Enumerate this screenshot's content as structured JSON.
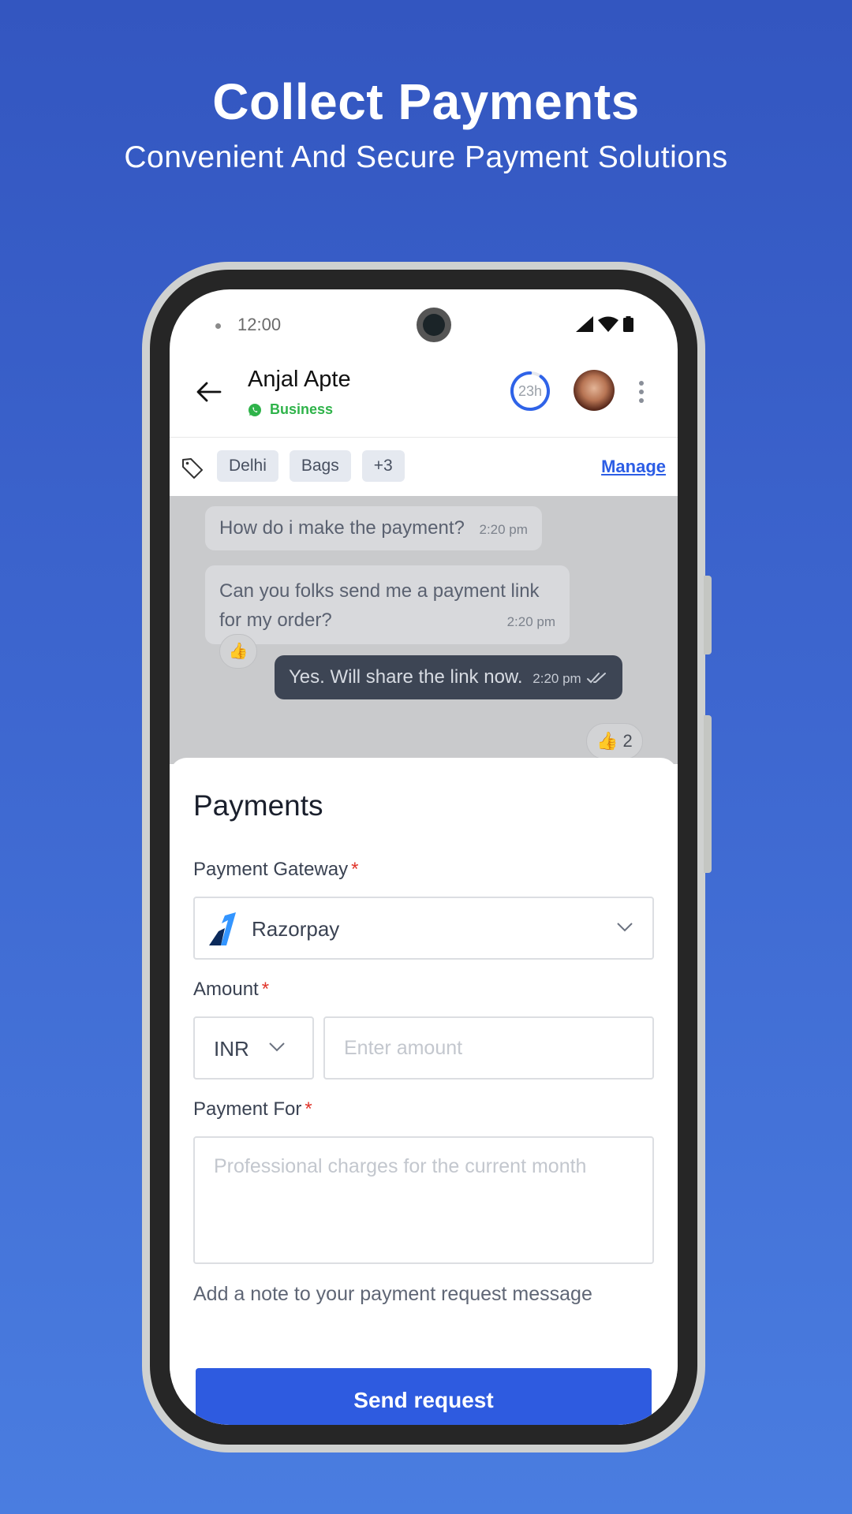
{
  "hero": {
    "title": "Collect Payments",
    "subtitle": "Convenient And Secure Payment Solutions"
  },
  "status_bar": {
    "time": "12:00",
    "icons": [
      "signal-icon",
      "wifi-icon",
      "battery-icon"
    ]
  },
  "chat_header": {
    "contact_name": "Anjal Apte",
    "channel_label": "Business",
    "channel_icon": "whatsapp-icon",
    "timer_label": "23h",
    "timer_fraction_remaining": 0.9
  },
  "tags_bar": {
    "tags": [
      "Delhi",
      "Bags",
      "+3"
    ],
    "manage_label": "Manage"
  },
  "messages": [
    {
      "direction": "incoming",
      "text": "How do i make the payment?",
      "time": "2:20 pm"
    },
    {
      "direction": "incoming",
      "text": "Can you folks send me a payment link for my order?",
      "time": "2:20 pm",
      "reaction": "👍"
    },
    {
      "direction": "outgoing",
      "text": "Yes. Will share the link now.",
      "time": "2:20 pm",
      "status": "read",
      "reaction": "👍",
      "reaction_count": "2"
    }
  ],
  "payments_sheet": {
    "title": "Payments",
    "gateway": {
      "label": "Payment Gateway",
      "required_mark": "*",
      "value": "Razorpay"
    },
    "amount": {
      "label": "Amount",
      "required_mark": "*",
      "currency": "INR",
      "placeholder": "Enter amount",
      "value": ""
    },
    "payment_for": {
      "label": "Payment For",
      "required_mark": "*",
      "placeholder": "Professional charges for the current month",
      "value": ""
    },
    "helper_text": "Add a note to your payment request message",
    "submit_label": "Send request"
  },
  "colors": {
    "primary": "#2e5be0",
    "link": "#2c5de5",
    "whatsapp_green": "#2fb34a",
    "required": "#e0342a",
    "outgoing_bubble": "#3d4554"
  }
}
